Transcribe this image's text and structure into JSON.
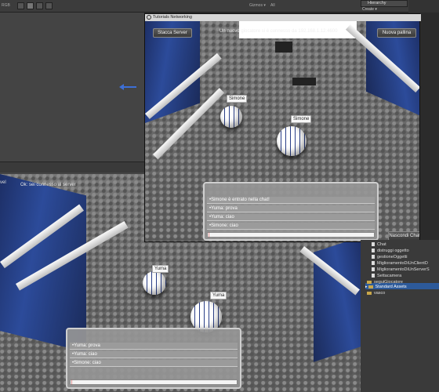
{
  "editor": {
    "topbar_left": "RGB",
    "topbar_gizmos": "Gizmos ▾",
    "topbar_all": "All",
    "hierarchy_tab": "Hierarchy",
    "hierarchy_create": "Create ▾",
    "bottom_status_left": "vel",
    "bottom_status_msg": "Ok: sei connesso al server"
  },
  "server_window": {
    "title": "Tutorials Networking",
    "stop_button": "Stacca Server",
    "connect_message": "Un nuovo giocatore si è connesso da 192.168.1.12:4600",
    "new_ball_button": "Nuova pallina",
    "hide_chat_button": "Nascondi Chat",
    "labels": [
      "Simone",
      "Simone"
    ],
    "chat_lines": [
      "•Simone è entrato nella chat!",
      "•Yuma: prova",
      "•Yuma: ciao",
      "•Simone: ciao"
    ],
    "chat_input": "|"
  },
  "client_view": {
    "labels": [
      "Yuma",
      "Yuma"
    ],
    "chat_lines": [
      "•Yuma: prova",
      "•Yuma: ciao",
      "•Simone: ciao"
    ],
    "chat_input": "|"
  },
  "project_panel": {
    "items": [
      {
        "type": "file",
        "label": "Chat"
      },
      {
        "type": "file",
        "label": "distruggi oggetto"
      },
      {
        "type": "file",
        "label": "gestioneOggetti"
      },
      {
        "type": "file",
        "label": "MiglioramentoDiUnClientD"
      },
      {
        "type": "file",
        "label": "MiglioramentoDiUnServerS"
      },
      {
        "type": "file",
        "label": "Settacamera"
      },
      {
        "type": "folder",
        "label": "seguiGiocatore"
      },
      {
        "type": "folder",
        "label": "Standard Assets"
      },
      {
        "type": "folder",
        "label": "vasco"
      }
    ]
  }
}
